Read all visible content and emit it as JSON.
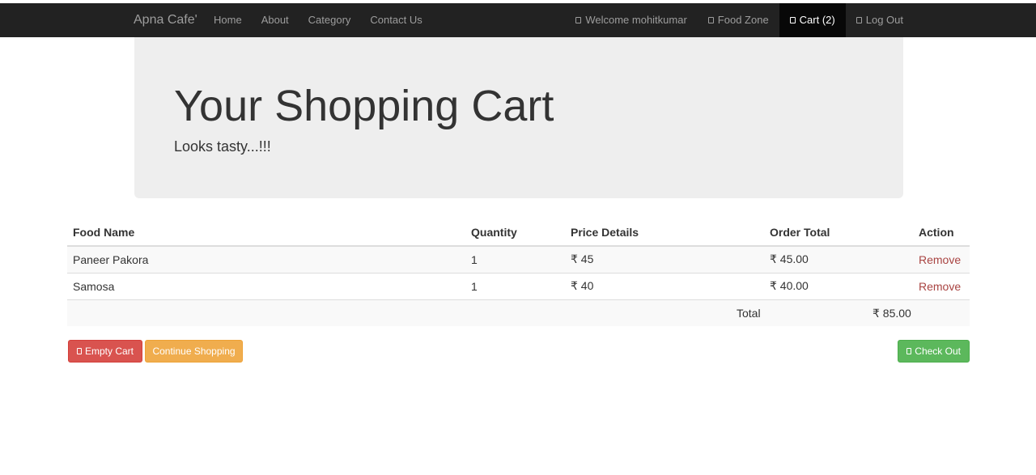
{
  "navbar": {
    "brand": "Apna Cafe'",
    "left_links": [
      "Home",
      "About",
      "Category",
      "Contact Us"
    ],
    "welcome": "Welcome mohitkumar",
    "food_zone": "Food Zone",
    "cart": "Cart (2)",
    "logout": "Log Out"
  },
  "jumbotron": {
    "title": "Your Shopping Cart",
    "subtitle": "Looks tasty...!!!"
  },
  "table": {
    "headers": [
      "Food Name",
      "Quantity",
      "Price Details",
      "Order Total",
      "Action"
    ],
    "rows": [
      {
        "name": "Paneer Pakora",
        "qty": "1",
        "price": "₹ 45",
        "total": "₹ 45.00",
        "action": "Remove"
      },
      {
        "name": "Samosa",
        "qty": "1",
        "price": "₹ 40",
        "total": "₹ 40.00",
        "action": "Remove"
      }
    ],
    "total_label": "Total",
    "total_value": "₹ 85.00"
  },
  "buttons": {
    "empty_cart": "Empty Cart",
    "continue_shopping": "Continue Shopping",
    "check_out": "Check Out"
  },
  "colors": {
    "navbar_bg": "#222222",
    "danger": "#d9534f",
    "warning": "#f0ad4e",
    "success": "#5cb85c",
    "remove_link": "#a94442"
  }
}
